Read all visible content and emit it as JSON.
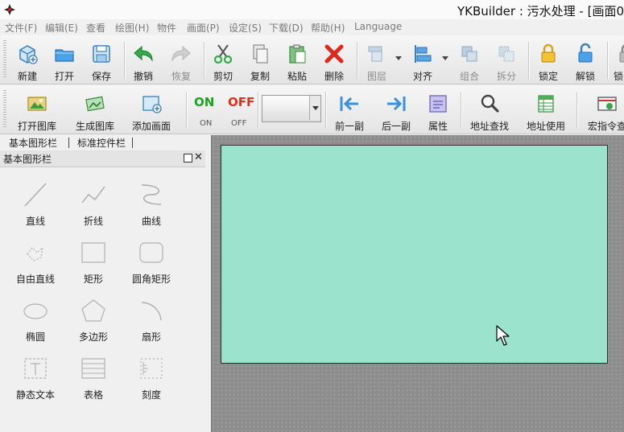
{
  "window": {
    "title": "YKBuilder : 污水处理 - [画面0"
  },
  "menu": [
    "文件(F)",
    "编辑(E)",
    "查看",
    "绘图(H)",
    "物件",
    "画面(P)",
    "设定(S)",
    "下载(D)",
    "帮助(H)",
    "Language"
  ],
  "toolbar1": {
    "new": "新建",
    "open": "打开",
    "save": "保存",
    "undo": "撤销",
    "redo": "恢复",
    "cut": "剪切",
    "copy": "复制",
    "paste": "粘贴",
    "delete": "删除",
    "layer": "图层",
    "align": "对齐",
    "group": "组合",
    "ungroup": "拆分",
    "lock": "锁定",
    "unlock": "解锁",
    "more": "锁"
  },
  "toolbar2": {
    "open_library": "打开图库",
    "build_library": "生成图库",
    "add_screen": "添加画面",
    "on": "ON",
    "off": "OFF",
    "on_sub": "ON",
    "off_sub": "OFF",
    "prev": "前一副",
    "next": "后一副",
    "props": "属性",
    "addr_find": "地址查找",
    "addr_use": "地址使用",
    "macro": "宏指令查"
  },
  "panel": {
    "tabs": [
      "基本图形栏",
      "标准控件栏"
    ],
    "title": "基本图形栏",
    "shapes": [
      "直线",
      "折线",
      "曲线",
      "自由直线",
      "矩形",
      "圆角矩形",
      "椭圆",
      "多边形",
      "扇形",
      "静态文本",
      "表格",
      "刻度"
    ]
  },
  "colors": {
    "canvas_page": "#9ce3cd",
    "workspace": "#8d8d8d",
    "on_green": "#1aa51a",
    "off_red": "#e0301e"
  }
}
